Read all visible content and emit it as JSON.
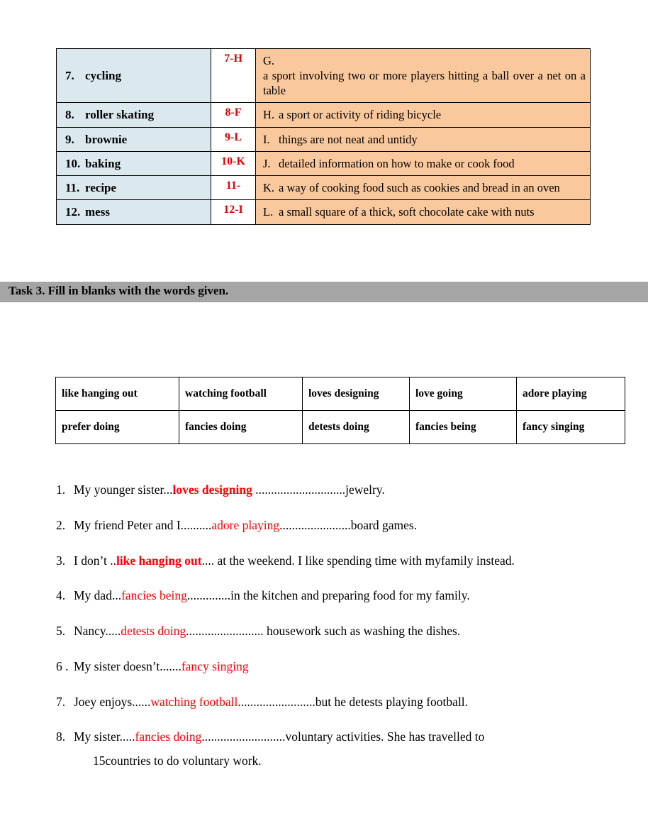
{
  "match_table": {
    "rows": [
      {
        "number": "7.",
        "word": "cycling",
        "key_num": "7",
        "key_sep": "-",
        "key_letter": "H",
        "def_label": "G.",
        "def_text": "a sport involving two or more players hitting a ball over a net on a table"
      },
      {
        "number": "8.",
        "word": "roller skating",
        "key_num": "8",
        "key_sep": "-",
        "key_letter": "F",
        "def_label": "H.",
        "def_text": "a sport or activity of riding bicycle"
      },
      {
        "number": "9.",
        "word": "brownie",
        "key_num": "9",
        "key_sep": "-",
        "key_letter": "L",
        "def_label": "I.",
        "def_text": "things are not neat and untidy"
      },
      {
        "number": "10.",
        "word": "baking",
        "key_num": "10",
        "key_sep": "-",
        "key_letter": "K",
        "def_label": "J.",
        "def_text": "detailed information on how to make or cook food"
      },
      {
        "number": "11.",
        "word": "recipe",
        "key_num": "11",
        "key_sep": "-",
        "key_letter": "",
        "def_label": "K.",
        "def_text": "a way of cooking food such as cookies and bread in an oven"
      },
      {
        "number": "12.",
        "word": "mess",
        "key_num": "12",
        "key_sep": "-",
        "key_letter": "I",
        "def_label": "L.",
        "def_text": "a small square of a thick, soft chocolate cake with nuts"
      }
    ]
  },
  "task_banner": {
    "title": "Task 3. Fill in blanks with the words given."
  },
  "wordbank": {
    "rows": [
      [
        "like hanging out",
        "watching football",
        "loves designing",
        "love going",
        "adore playing"
      ],
      [
        "prefer doing",
        "fancies doing",
        "detests doing",
        "fancies being",
        "fancy singing"
      ]
    ]
  },
  "sentences": [
    {
      "number": "1.",
      "pre": "My younger sister...",
      "answer": "loves designing",
      "bold": true,
      "post": " .............................jewelry.",
      "line2": ""
    },
    {
      "number": "2.",
      "pre": "My friend Peter and I..........",
      "answer": "adore playing",
      "bold": false,
      "post": ".......................board games.",
      "line2": ""
    },
    {
      "number": "3.",
      "pre": "I don’t ..",
      "answer": "like hanging out",
      "bold": true,
      "post": ".... at the weekend. I like spending time with myfamily instead.",
      "line2": ""
    },
    {
      "number": "4.",
      "pre": "My dad...",
      "answer": "fancies being",
      "bold": false,
      "post": "..............in the kitchen and preparing food for my family.",
      "line2": ""
    },
    {
      "number": "5.",
      "pre": "Nancy.....",
      "answer": "detests doing",
      "bold": false,
      "post": "......................... housework such as washing the dishes.",
      "line2": ""
    },
    {
      "number": "6 .",
      "pre": "My sister doesn’t.......",
      "answer": "fancy singing",
      "bold": false,
      "post": "",
      "line2": ""
    },
    {
      "number": "7.",
      "pre": "Joey enjoys......",
      "answer": "watching football",
      "bold": false,
      "post": ".........................but he detests playing football.",
      "line2": ""
    },
    {
      "number": "8.",
      "pre": "My sister.....",
      "answer": "fancies doing",
      "bold": false,
      "post": "...........................voluntary activities. She has travelled to",
      "line2": "15countries to do voluntary work."
    }
  ],
  "colors": {
    "answer_red": "#ff0000",
    "key_red": "#e00000",
    "word_cell_bg": "#dbe9ef",
    "def_cell_bg": "#fac89d",
    "banner_gray": "#a5a5a5"
  }
}
